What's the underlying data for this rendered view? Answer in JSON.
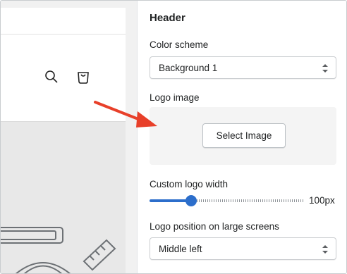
{
  "panel": {
    "title": "Header",
    "color_scheme": {
      "label": "Color scheme",
      "value": "Background 1"
    },
    "logo_image": {
      "label": "Logo image",
      "button_label": "Select Image"
    },
    "logo_width": {
      "label": "Custom logo width",
      "value_text": "100px",
      "level": 0.27
    },
    "logo_position": {
      "label": "Logo position on large screens",
      "value": "Middle left"
    }
  },
  "preview": {
    "icons": [
      "search-icon",
      "cart-icon"
    ]
  },
  "colors": {
    "accent": "#2c6ecb",
    "annotation_arrow": "#e8402a",
    "preview_bg": "#e8e8e8"
  }
}
